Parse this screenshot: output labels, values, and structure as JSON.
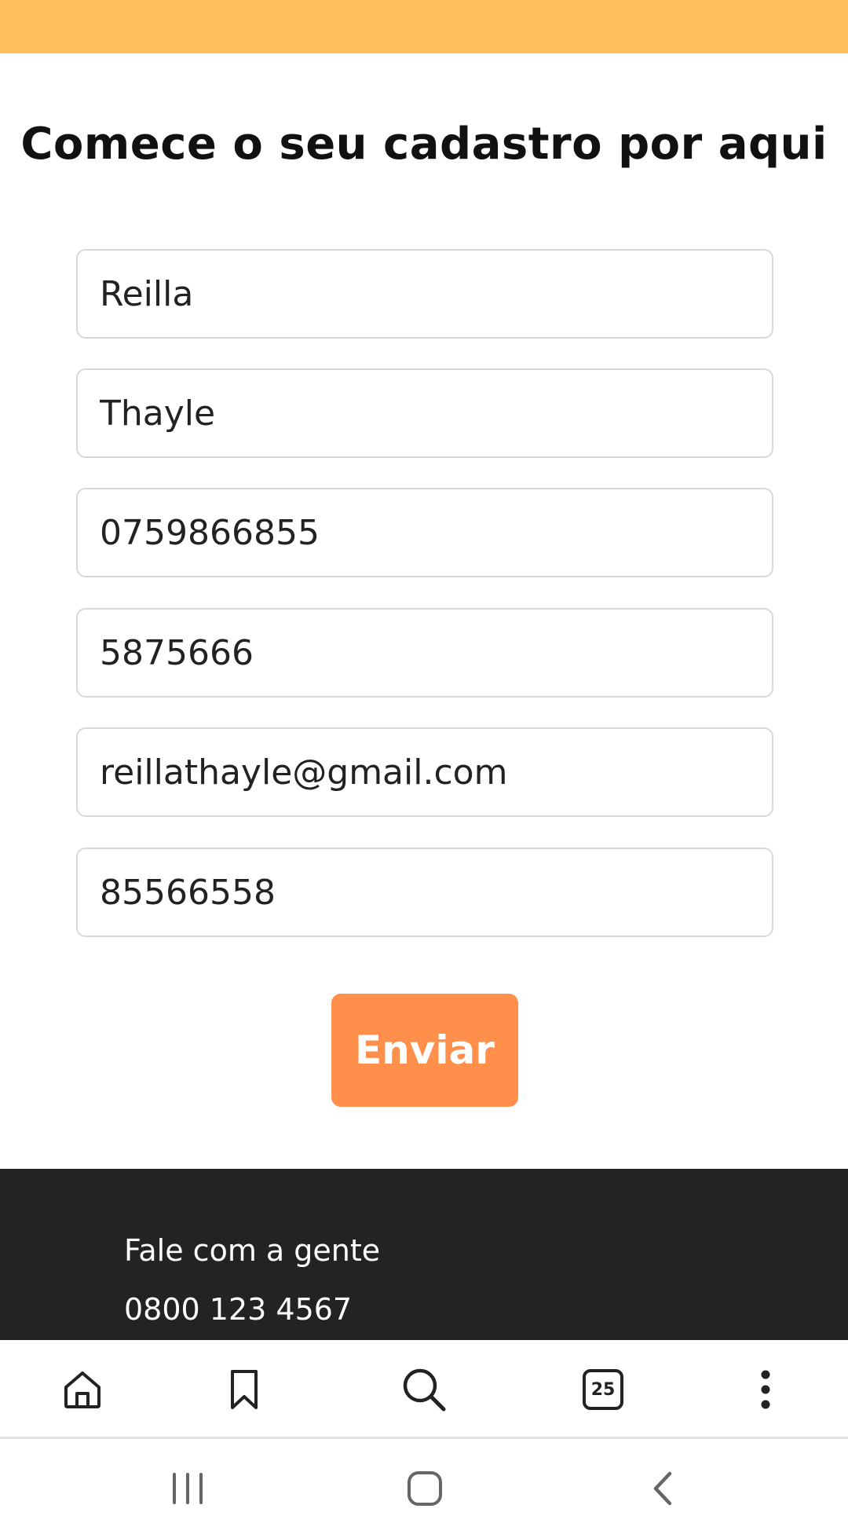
{
  "header": {
    "title": "Comece o seu cadastro por aqui"
  },
  "form": {
    "fields": [
      {
        "value": "Reilla"
      },
      {
        "value": "Thayle"
      },
      {
        "value": "0759866855"
      },
      {
        "value": "5875666"
      },
      {
        "value": "reillathayle@gmail.com"
      },
      {
        "value": "85566558"
      }
    ],
    "submit_label": "Enviar"
  },
  "footer": {
    "contact_label": "Fale com a gente",
    "phone": "0800 123 4567"
  },
  "browser_toolbar": {
    "items": [
      {
        "icon": "home-icon"
      },
      {
        "icon": "bookmark-icon"
      },
      {
        "icon": "search-icon"
      },
      {
        "icon": "tabs-icon",
        "count": "25"
      },
      {
        "icon": "more-vertical-icon"
      }
    ]
  },
  "system_nav": {
    "items": [
      {
        "icon": "recent-apps-icon"
      },
      {
        "icon": "home-button-icon"
      },
      {
        "icon": "back-icon"
      }
    ]
  },
  "colors": {
    "top_bar": "#FFBE5C",
    "button": "#FF8F4A",
    "footer": "#232323"
  }
}
